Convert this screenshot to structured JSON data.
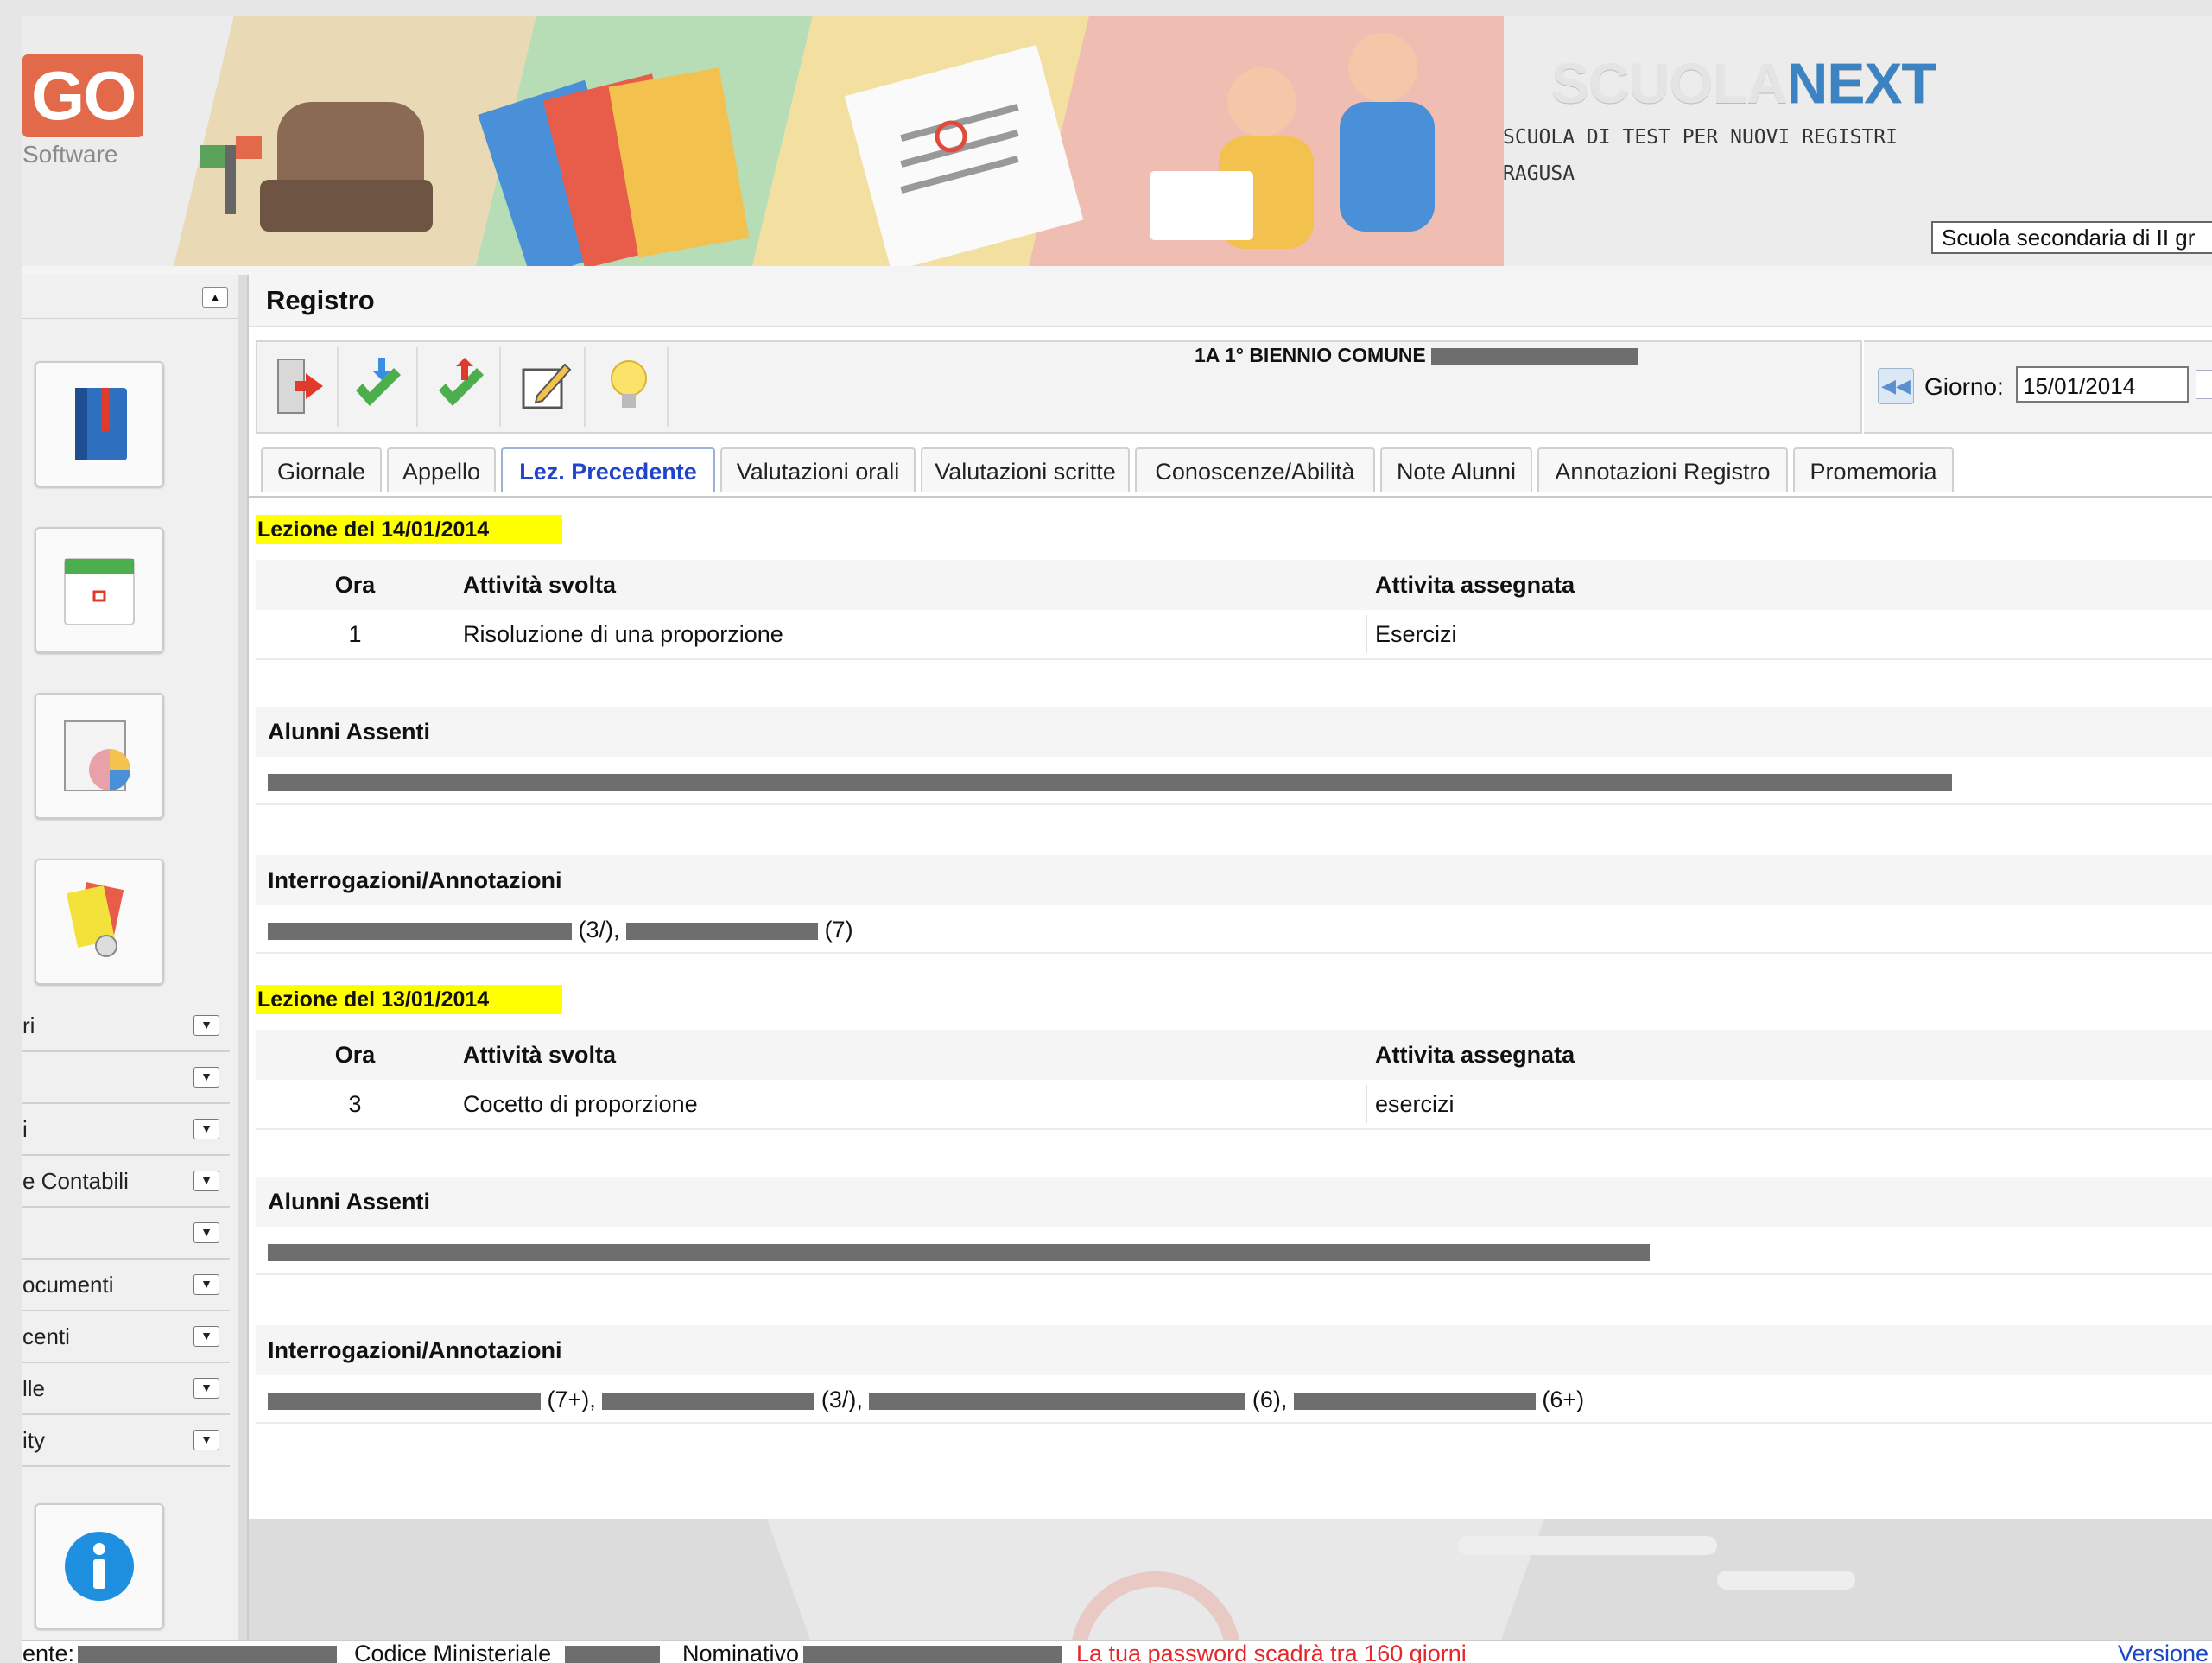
{
  "header": {
    "logo_text": "GO",
    "logo_sub": "Software",
    "brand_part1": "SCUOLA",
    "brand_part2": "NEXT",
    "school_name": "SCUOLA DI TEST PER NUOVI REGISTRI",
    "school_city": "RAGUSA",
    "school_type_selected": "Scuola secondaria di II gr"
  },
  "sidebar": {
    "tiles": [
      "register-book",
      "calendar",
      "statistics",
      "reports"
    ],
    "rows": [
      {
        "label": "ri"
      },
      {
        "label": ""
      },
      {
        "label": "i"
      },
      {
        "label": "e Contabili"
      },
      {
        "label": ""
      },
      {
        "label": "ocumenti"
      },
      {
        "label": "centi"
      },
      {
        "label": "lle"
      },
      {
        "label": "ity"
      }
    ],
    "info_icon": "info-icon"
  },
  "main": {
    "title": "Registro",
    "class_name": "1A 1° BIENNIO COMUNE",
    "day_label": "Giorno:",
    "day_value": "15/01/2014",
    "tabs": [
      {
        "label": "Giornale"
      },
      {
        "label": "Appello"
      },
      {
        "label": "Lez. Precedente"
      },
      {
        "label": "Valutazioni orali"
      },
      {
        "label": "Valutazioni scritte"
      },
      {
        "label": "Conoscenze/Abilità"
      },
      {
        "label": "Note Alunni"
      },
      {
        "label": "Annotazioni Registro"
      },
      {
        "label": "Promemoria"
      }
    ],
    "active_tab": "Lez. Precedente",
    "columns": {
      "ora": "Ora",
      "svolta": "Attività svolta",
      "assegnata": "Attivita assegnata"
    },
    "section_absent": "Alunni Assenti",
    "section_notes": "Interrogazioni/Annotazioni",
    "lessons": [
      {
        "header": "Lezione del 14/01/2014",
        "ora": "1",
        "svolta": "Risoluzione di una proporzione",
        "assegnata": "Esercizi",
        "grades": [
          "(3/),",
          "(7)"
        ]
      },
      {
        "header": "Lezione del 13/01/2014",
        "ora": "3",
        "svolta": "Cocetto di proporzione",
        "assegnata": "esercizi",
        "grades": [
          "(7+),",
          "(3/),",
          "(6),",
          "(6+)"
        ]
      }
    ]
  },
  "status": {
    "ente_label": "ente:",
    "codice_label": "Codice Ministeriale",
    "nominativo_label": "Nominativo",
    "password_warning": "La tua password scadrà tra 160 giorni",
    "version_link": "Versione"
  },
  "colors": {
    "highlight": "#ffff00",
    "active_tab": "#2143c9",
    "warning": "#e3272a",
    "brand_blue": "#3b83c3"
  }
}
